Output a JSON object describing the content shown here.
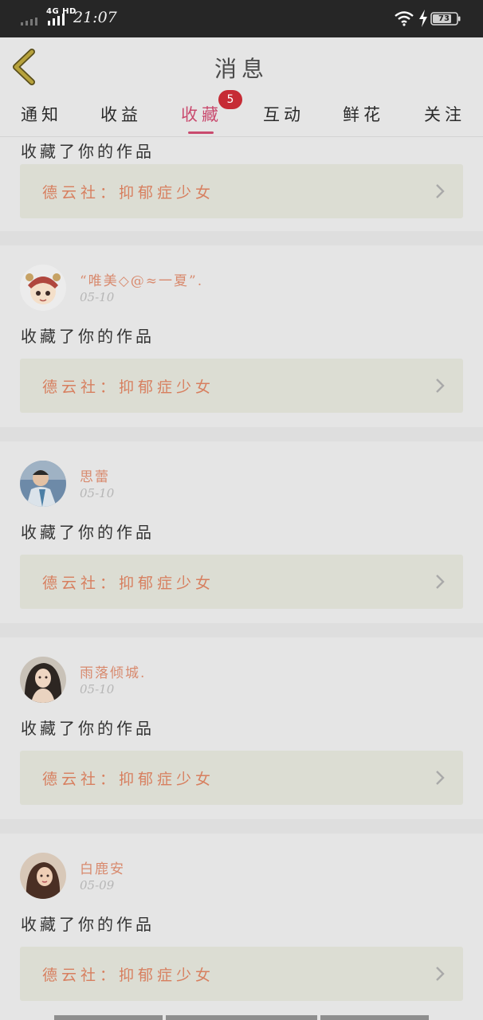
{
  "status_bar": {
    "network": "4G HD",
    "time": "21:07",
    "battery": "73"
  },
  "header": {
    "title": "消息"
  },
  "tabs": [
    {
      "label": "通知",
      "active": false
    },
    {
      "label": "收益",
      "active": false
    },
    {
      "label": "收藏",
      "active": true,
      "badge": "5"
    },
    {
      "label": "互动",
      "active": false
    },
    {
      "label": "鲜花",
      "active": false
    },
    {
      "label": "关注",
      "active": false
    }
  ],
  "feed": {
    "partial_card": {
      "action": "收藏了你的作品",
      "work_title": "德云社：抑郁症少女"
    },
    "items": [
      {
        "username": "“唯美◇@≈一夏”.",
        "date": "05-10",
        "action": "收藏了你的作品",
        "work_title": "德云社：抑郁症少女"
      },
      {
        "username": "思蕾",
        "date": "05-10",
        "action": "收藏了你的作品",
        "work_title": "德云社：抑郁症少女"
      },
      {
        "username": "雨落倾城.",
        "date": "05-10",
        "action": "收藏了你的作品",
        "work_title": "德云社：抑郁症少女"
      },
      {
        "username": "白鹿安",
        "date": "05-09",
        "action": "收藏了你的作品",
        "work_title": "德云社：抑郁症少女"
      }
    ]
  },
  "colors": {
    "accent": "#c94a6e",
    "badge": "#c62b35",
    "username": "#d88a6e",
    "work_title": "#d77f5f",
    "back_arrow": "#b7a23c"
  }
}
